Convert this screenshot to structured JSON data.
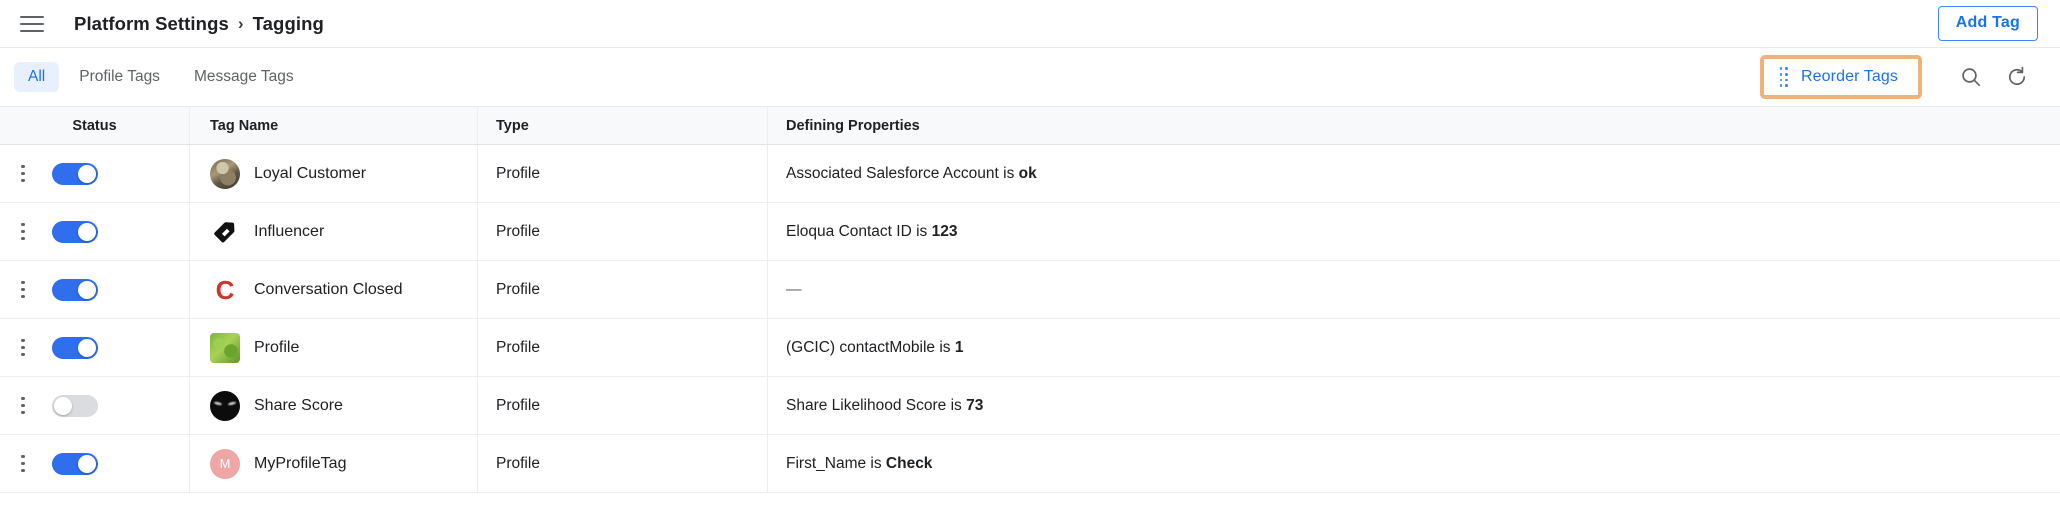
{
  "header": {
    "menu_icon": "hamburger-icon",
    "breadcrumb": {
      "parent": "Platform Settings",
      "separator": "›",
      "current": "Tagging"
    },
    "add_tag_label": "Add Tag"
  },
  "toolbar": {
    "tabs": [
      {
        "label": "All",
        "active": true
      },
      {
        "label": "Profile Tags",
        "active": false
      },
      {
        "label": "Message Tags",
        "active": false
      }
    ],
    "reorder_label": "Reorder Tags",
    "search_icon": "search-icon",
    "refresh_icon": "refresh-icon",
    "highlight_color": "#f0b27a"
  },
  "table": {
    "columns": [
      "Status",
      "Tag Name",
      "Type",
      "Defining Properties"
    ],
    "rows": [
      {
        "enabled": true,
        "icon": "avatar-photo",
        "name": "Loyal Customer",
        "type": "Profile",
        "prop_text": "Associated Salesforce Account is ",
        "prop_value": "ok"
      },
      {
        "enabled": true,
        "icon": "tag-icon",
        "name": "Influencer",
        "type": "Profile",
        "prop_text": "Eloqua Contact ID is ",
        "prop_value": "123"
      },
      {
        "enabled": true,
        "icon": "letter-c-icon",
        "name": "Conversation Closed",
        "type": "Profile",
        "prop_text": "—",
        "prop_value": ""
      },
      {
        "enabled": true,
        "icon": "avatar-green",
        "name": "Profile",
        "type": "Profile",
        "prop_text": "(GCIC) contactMobile is ",
        "prop_value": "1"
      },
      {
        "enabled": false,
        "icon": "avatar-black",
        "name": "Share Score",
        "type": "Profile",
        "prop_text": "Share Likelihood Score is ",
        "prop_value": "73"
      },
      {
        "enabled": true,
        "icon": "avatar-initial-m",
        "name": "MyProfileTag",
        "type": "Profile",
        "prop_text": "First_Name is ",
        "prop_value": "Check",
        "initial": "M"
      }
    ]
  },
  "colors": {
    "accent": "#1a73e8",
    "toggle_on": "#2f6fed",
    "toggle_off": "#dadce0",
    "highlight": "#f0b27a"
  }
}
